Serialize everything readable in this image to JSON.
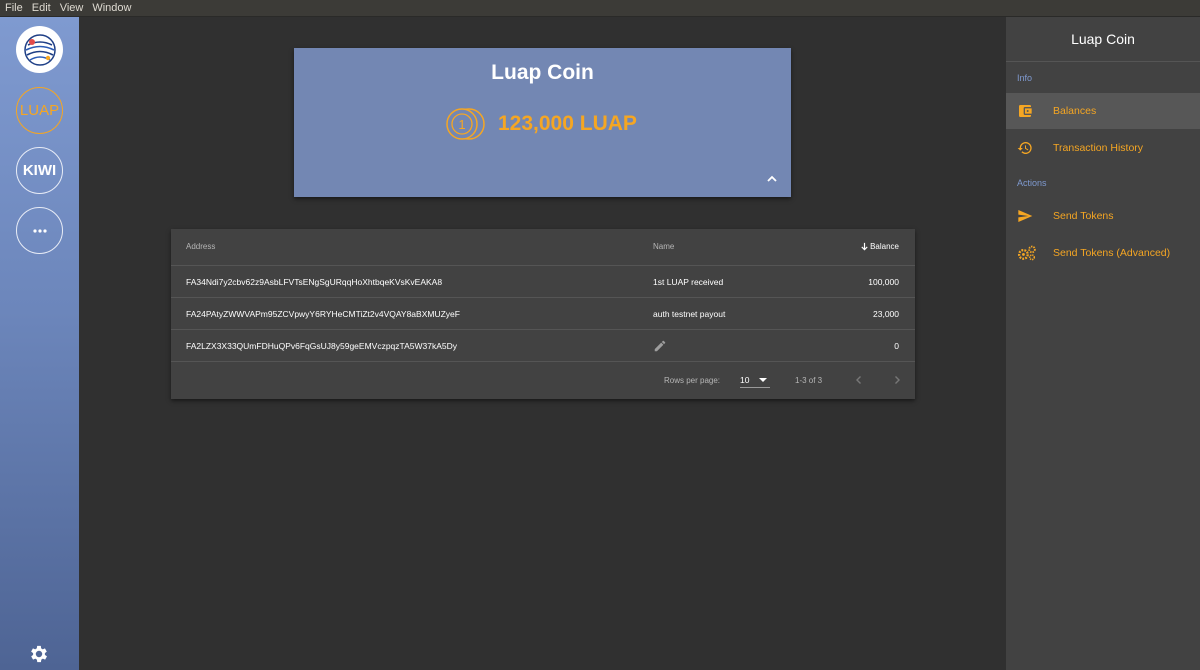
{
  "menubar": {
    "items": [
      "File",
      "Edit",
      "View",
      "Window"
    ]
  },
  "sidebar": {
    "accounts": [
      {
        "label": "LUAP"
      },
      {
        "label": "KIWI"
      },
      {
        "label": "···"
      }
    ],
    "accent_color": "#f5a623"
  },
  "coin_card": {
    "title": "Luap Coin",
    "balance": "123,000 LUAP",
    "background": "#7387b3"
  },
  "table": {
    "columns": {
      "address": "Address",
      "name": "Name",
      "balance": "Balance"
    },
    "rows": [
      {
        "address": "FA34Ndi7y2cbv62z9AsbLFVTsENgSgURqqHoXhtbqeKVsKvEAKA8",
        "name": "1st LUAP received",
        "balance": "100,000"
      },
      {
        "address": "FA24PAtyZWWVAPm95ZCVpwyY6RYHeCMTiZt2v4VQAY8aBXMUZyeF",
        "name": "auth testnet payout",
        "balance": "23,000"
      },
      {
        "address": "FA2LZX3X33QUmFDHuQPv6FqGsUJ8y59geEMVczpqzTA5W37kA5Dy",
        "name": "",
        "balance": "0"
      }
    ],
    "footer": {
      "rows_per_page_label": "Rows per page:",
      "rows_per_page": "10",
      "range": "1-3 of 3"
    }
  },
  "right_panel": {
    "title": "Luap Coin",
    "info_label": "Info",
    "actions_label": "Actions",
    "items": [
      {
        "label": "Balances",
        "icon": "wallet-icon",
        "active": true
      },
      {
        "label": "Transaction History",
        "icon": "history-icon",
        "active": false
      },
      {
        "label": "Send Tokens",
        "icon": "send-icon",
        "active": false
      },
      {
        "label": "Send Tokens (Advanced)",
        "icon": "gears-icon",
        "active": false
      }
    ]
  }
}
